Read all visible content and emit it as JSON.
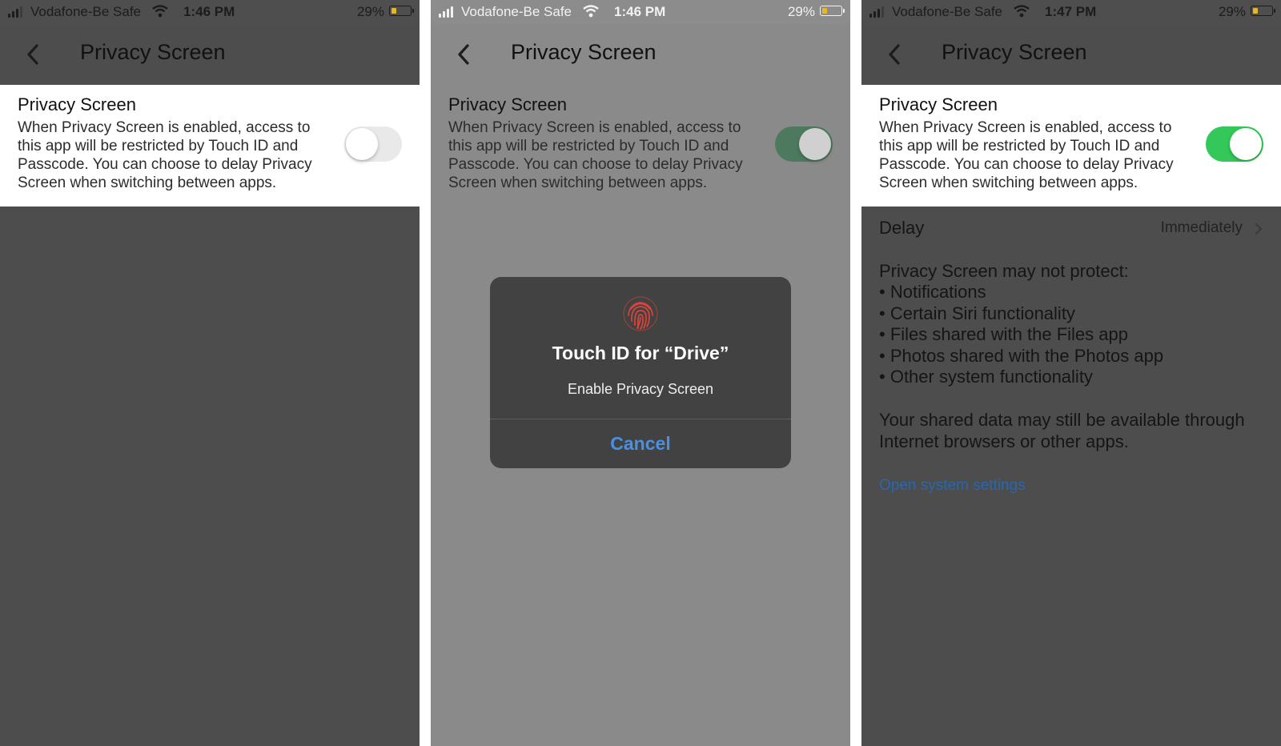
{
  "colors": {
    "toggle_on_dim": "#4d7a5e",
    "toggle_on": "#34c759",
    "toggle_off": "#e9e9ea",
    "link_blue": "#2a66ad",
    "cancel_blue": "#4a90e2",
    "battery_fill": "#e4b82a",
    "fingerprint_red": "#d9453a"
  },
  "panels": [
    {
      "status": {
        "carrier": "Vodafone-Be Safe",
        "time": "1:46 PM",
        "battery": "29%"
      },
      "nav": {
        "title": "Privacy Screen"
      },
      "setting": {
        "title": "Privacy Screen",
        "description": "When Privacy Screen is enabled, access to this app will be restricted by Touch ID and Passcode. You can choose to delay Privacy Screen when switching between apps.",
        "toggle_state": "off"
      }
    },
    {
      "status": {
        "carrier": "Vodafone-Be Safe",
        "time": "1:46 PM",
        "battery": "29%"
      },
      "nav": {
        "title": "Privacy Screen"
      },
      "setting": {
        "title": "Privacy Screen",
        "description": "When Privacy Screen is enabled, access to this app will be restricted by Touch ID and Passcode. You can choose to delay Privacy Screen when switching between apps.",
        "toggle_state": "on"
      },
      "dialog": {
        "icon": "fingerprint-icon",
        "title": "Touch ID for “Drive”",
        "subtitle": "Enable Privacy Screen",
        "cancel": "Cancel"
      }
    },
    {
      "status": {
        "carrier": "Vodafone-Be Safe",
        "time": "1:47 PM",
        "battery": "29%"
      },
      "nav": {
        "title": "Privacy Screen"
      },
      "setting": {
        "title": "Privacy Screen",
        "description": "When Privacy Screen is enabled, access to this app will be restricted by Touch ID and Passcode. You can choose to delay Privacy Screen when switching between apps.",
        "toggle_state": "on"
      },
      "delay": {
        "label": "Delay",
        "value": "Immediately"
      },
      "protection": {
        "title": "Privacy Screen may not protect:",
        "items": [
          "Notifications",
          "Certain Siri functionality",
          "Files shared with the Files app",
          "Photos shared with the Photos app",
          "Other system functionality"
        ],
        "note": "Your shared data may still be available through Internet browsers or other apps."
      },
      "link": {
        "label": "Open system settings"
      }
    }
  ]
}
